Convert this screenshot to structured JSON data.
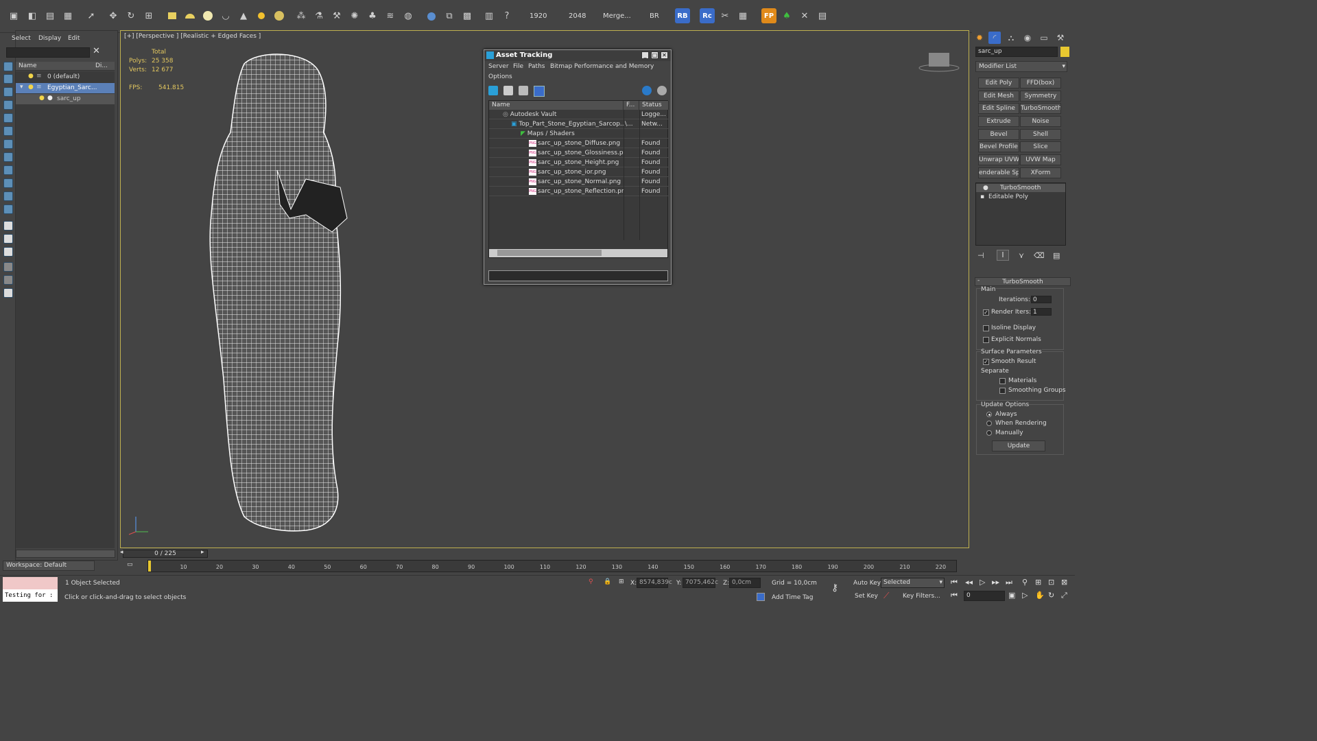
{
  "toolbar": {
    "res_width": "1920",
    "res_height": "2048",
    "merge_label": "Merge...",
    "br_label": "BR",
    "rb_label": "RB",
    "rc_label": "Rc",
    "fp_label": "FP"
  },
  "scene_explorer": {
    "menu": [
      "Select",
      "Display",
      "Edit"
    ],
    "col_name": "Name",
    "col_display": "Di...",
    "rows": [
      {
        "label": "0 (default)"
      },
      {
        "label": "Egyptian_Sarc..."
      },
      {
        "label": "sarc_up"
      }
    ],
    "workspace": "Workspace: Default"
  },
  "viewport": {
    "label": "[+] [Perspective ] [Realistic + Edged Faces ]",
    "total_label": "Total",
    "polys_label": "Polys:",
    "polys_value": "25 358",
    "verts_label": "Verts:",
    "verts_value": "12 677",
    "fps_label": "FPS:",
    "fps_value": "541.815"
  },
  "asset_tracking": {
    "title": "Asset Tracking",
    "menu": [
      "Server",
      "File",
      "Paths",
      "Bitmap Performance and Memory"
    ],
    "menu2": "Options",
    "columns": [
      "Name",
      "F...",
      "Status"
    ],
    "rows": [
      {
        "name": "Autodesk Vault",
        "f": "",
        "status": "Logge..."
      },
      {
        "name": "Top_Part_Stone_Egyptian_Sarcop...",
        "f": "\\...",
        "status": "Netw..."
      },
      {
        "name": "Maps / Shaders",
        "f": "",
        "status": ""
      },
      {
        "name": "sarc_up_stone_Diffuse.png",
        "f": "",
        "status": "Found"
      },
      {
        "name": "sarc_up_stone_Glossiness.png",
        "f": "",
        "status": "Found"
      },
      {
        "name": "sarc_up_stone_Height.png",
        "f": "",
        "status": "Found"
      },
      {
        "name": "sarc_up_stone_ior.png",
        "f": "",
        "status": "Found"
      },
      {
        "name": "sarc_up_stone_Normal.png",
        "f": "",
        "status": "Found"
      },
      {
        "name": "sarc_up_stone_Reflection.png",
        "f": "",
        "status": "Found"
      }
    ]
  },
  "command_panel": {
    "object_name": "sarc_up",
    "modifier_list": "Modifier List",
    "modifier_buttons": [
      "Edit Poly",
      "FFD(box)",
      "Edit Mesh",
      "Symmetry",
      "Edit Spline",
      "TurboSmooth",
      "Extrude",
      "Noise",
      "Bevel",
      "Shell",
      "Bevel Profile",
      "Slice",
      "Unwrap UVW",
      "UVW Map",
      "enderable Splir",
      "XForm"
    ],
    "stack": [
      "TurboSmooth",
      "Editable Poly"
    ],
    "rollout_title": "TurboSmooth",
    "main_label": "Main",
    "iterations_label": "Iterations:",
    "iterations_value": "0",
    "render_iters_label": "Render Iters:",
    "render_iters_value": "1",
    "isoline_label": "Isoline Display",
    "explicit_normals_label": "Explicit Normals",
    "surface_params_label": "Surface Parameters",
    "smooth_result_label": "Smooth Result",
    "separate_label": "Separate",
    "materials_label": "Materials",
    "smoothing_groups_label": "Smoothing Groups",
    "update_options_label": "Update Options",
    "always_label": "Always",
    "when_rendering_label": "When Rendering",
    "manually_label": "Manually",
    "update_button": "Update"
  },
  "timeline": {
    "frame_display": "0 / 225",
    "ticks": [
      "10",
      "20",
      "30",
      "40",
      "50",
      "60",
      "70",
      "80",
      "90",
      "100",
      "110",
      "120",
      "130",
      "140",
      "150",
      "160",
      "170",
      "180",
      "190",
      "200",
      "210",
      "220"
    ]
  },
  "status_bar": {
    "script_text": "Testing for :",
    "selection": "1 Object Selected",
    "prompt": "Click or click-and-drag to select objects",
    "x_label": "X:",
    "x_value": "8574,839c",
    "y_label": "Y:",
    "y_value": "7075,462c",
    "z_label": "Z:",
    "z_value": "0,0cm",
    "grid": "Grid = 10,0cm",
    "add_time_tag": "Add Time Tag",
    "auto_key": "Auto Key",
    "set_key": "Set Key",
    "key_mode": "Selected",
    "key_filters": "Key Filters...",
    "frame_value": "0"
  }
}
